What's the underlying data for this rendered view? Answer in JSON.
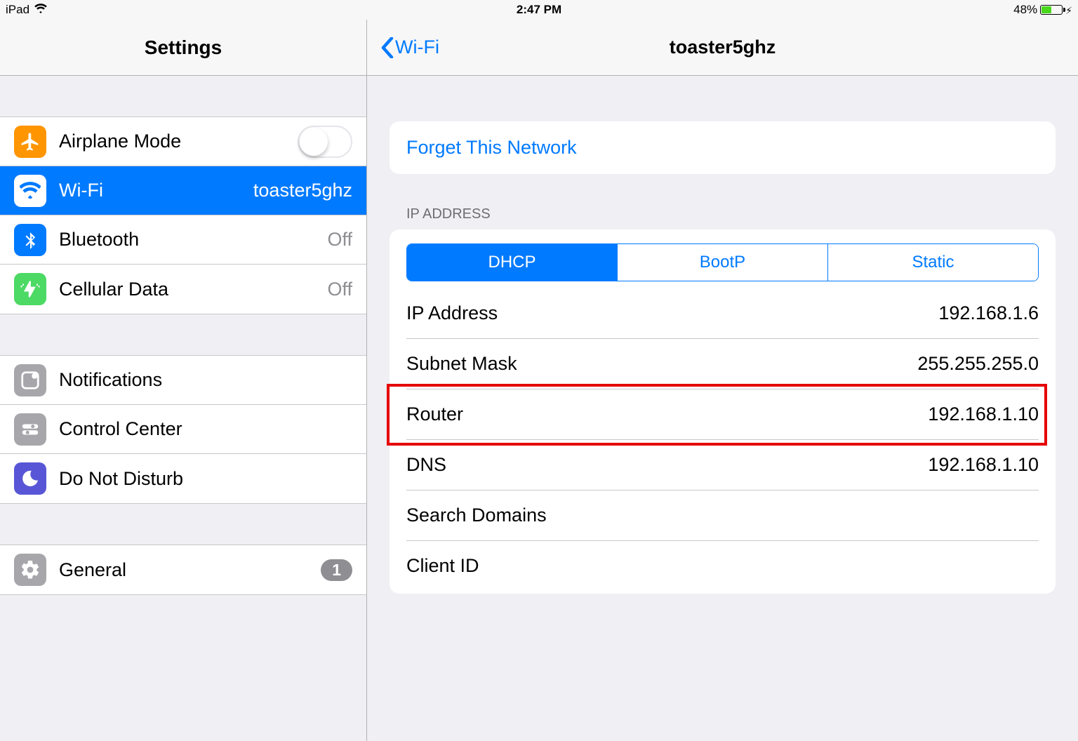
{
  "statusbar": {
    "device": "iPad",
    "time": "2:47 PM",
    "battery_pct": "48%"
  },
  "sidebar": {
    "title": "Settings",
    "groups": [
      {
        "items": [
          {
            "key": "airplane",
            "label": "Airplane Mode",
            "value": "",
            "toggle": false
          },
          {
            "key": "wifi",
            "label": "Wi-Fi",
            "value": "toaster5ghz",
            "selected": true
          },
          {
            "key": "bluetooth",
            "label": "Bluetooth",
            "value": "Off"
          },
          {
            "key": "cellular",
            "label": "Cellular Data",
            "value": "Off"
          }
        ]
      },
      {
        "items": [
          {
            "key": "notifications",
            "label": "Notifications"
          },
          {
            "key": "controlcenter",
            "label": "Control Center"
          },
          {
            "key": "dnd",
            "label": "Do Not Disturb"
          }
        ]
      },
      {
        "items": [
          {
            "key": "general",
            "label": "General",
            "badge": "1"
          }
        ]
      }
    ]
  },
  "detail": {
    "back_label": "Wi-Fi",
    "title": "toaster5ghz",
    "forget_label": "Forget This Network",
    "ip_section_label": "IP ADDRESS",
    "segments": {
      "dhcp": "DHCP",
      "bootp": "BootP",
      "static": "Static",
      "selected": "dhcp"
    },
    "rows": {
      "ip": {
        "label": "IP Address",
        "value": "192.168.1.6"
      },
      "subnet": {
        "label": "Subnet Mask",
        "value": "255.255.255.0"
      },
      "router": {
        "label": "Router",
        "value": "192.168.1.10"
      },
      "dns": {
        "label": "DNS",
        "value": "192.168.1.10"
      },
      "search": {
        "label": "Search Domains",
        "value": ""
      },
      "client": {
        "label": "Client ID",
        "value": ""
      }
    }
  },
  "highlight_row": "router"
}
